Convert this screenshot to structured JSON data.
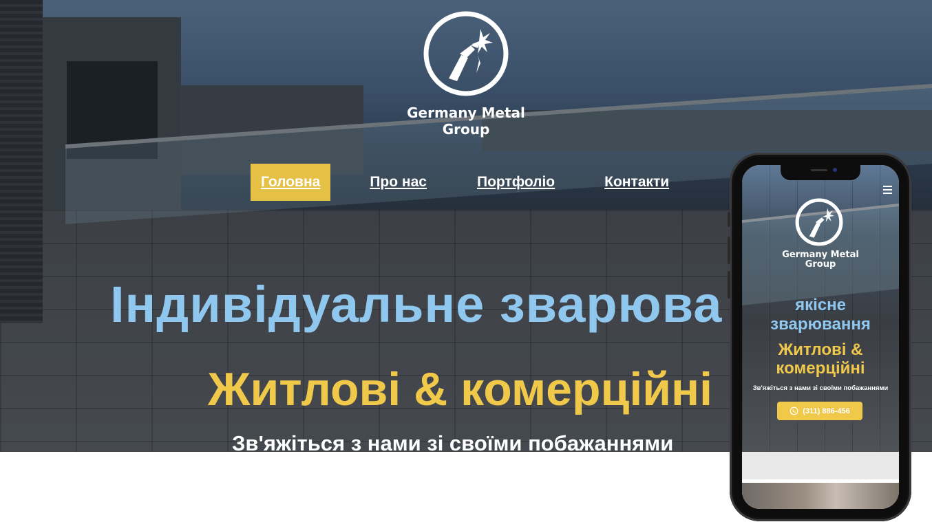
{
  "brand": {
    "line1": "Germany Metal",
    "line2": "Group",
    "logo_icon": "welding-torch-icon"
  },
  "nav": {
    "items": [
      {
        "label": "Головна",
        "active": true
      },
      {
        "label": "Про нас"
      },
      {
        "label": "Портфоліо"
      },
      {
        "label": "Контакти"
      }
    ]
  },
  "hero": {
    "headline": "Індивідуальне зварюва",
    "subheadline": "Житлові & комерційні",
    "tagline": "Зв'яжіться з нами зі своїми побажаннями"
  },
  "mobile": {
    "menu_icon": "hamburger-icon",
    "brand_line1": "Germany Metal",
    "brand_line2": "Group",
    "title_line1": "якісне",
    "title_line2": "зварювання",
    "sub_line1": "Житлові &",
    "sub_line2": "комерційні",
    "tagline": "Зв'яжіться з нами зі своїми побажаннями",
    "call_label": "(311) 886-456",
    "call_icon": "whatsapp-icon"
  },
  "colors": {
    "accent": "#e6c146",
    "headline_blue": "#8fc7ee",
    "subheadline_yellow": "#f0c84a"
  }
}
